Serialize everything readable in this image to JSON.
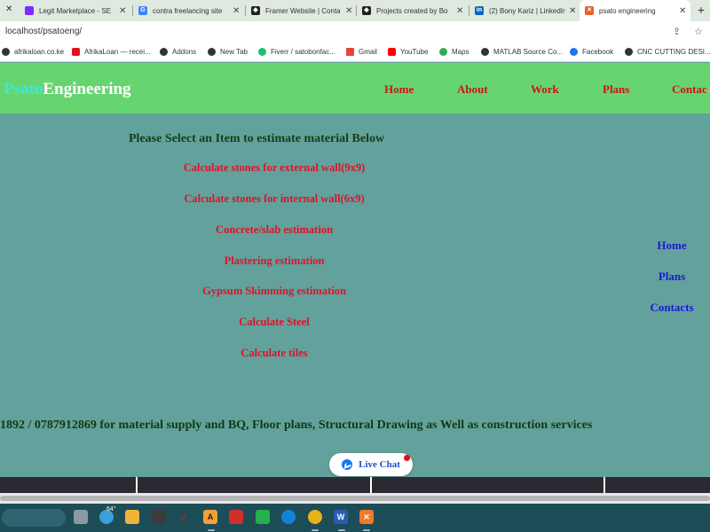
{
  "browser": {
    "tabs": [
      {
        "label": "Legit Marketplace - SE",
        "icon_color": "#7b2cff",
        "icon": "grid-icon"
      },
      {
        "label": "contra freelancing site",
        "icon_color": "#4285f4",
        "icon": "google-icon"
      },
      {
        "label": "Framer Website | Conta",
        "icon_color": "#222222",
        "icon": "framer-icon"
      },
      {
        "label": "Projects created by Bo",
        "icon_color": "#222222",
        "icon": "framer-icon"
      },
      {
        "label": "(2) Bony Kariz | LinkedIn",
        "icon_color": "#0a66c2",
        "icon": "linkedin-icon"
      },
      {
        "label": "psato engineering",
        "icon_color": "#e8612c",
        "icon": "xampp-icon",
        "active": true
      }
    ],
    "url": "localhost/psatoeng/",
    "bookmarks": [
      {
        "label": "afrikaloan.co.ke",
        "color": "#333333"
      },
      {
        "label": "AfrikaLoan — recei...",
        "color": "#e2101a"
      },
      {
        "label": "Addons",
        "color": "#333333"
      },
      {
        "label": "New Tab",
        "color": "#333333"
      },
      {
        "label": "Fiverr / satobonfac...",
        "color": "#1dbf73"
      },
      {
        "label": "Gmail",
        "color": "#ea4335"
      },
      {
        "label": "YouTube",
        "color": "#ff0000"
      },
      {
        "label": "Maps",
        "color": "#34a853"
      },
      {
        "label": "MATLAB Source Co...",
        "color": "#333333"
      },
      {
        "label": "Facebook",
        "color": "#1877f2"
      },
      {
        "label": "CNC CUTTING DESI...",
        "color": "#333333"
      }
    ]
  },
  "site": {
    "brand_part1": "Psato",
    "brand_part2": "Engineering",
    "nav": [
      "Home",
      "About",
      "Work",
      "Plans",
      "Contac"
    ],
    "heading": "Please Select an Item to estimate material Below",
    "calc_links": [
      "Calculate stones for external wall(9x9)",
      "Calculate stones for internal wall(6x9)",
      "Concrete/slab estimation",
      "Plastering estimation",
      "Gypsum Skimming estimation",
      "Calculate Steel",
      "Calculate tiles"
    ],
    "side_links": [
      "Home",
      "Plans",
      "Contacts"
    ],
    "contact_line": "1892 / 0787912869 for material supply and BQ, Floor plans, Structural Drawing as Well as construction services",
    "live_chat_label": "Live Chat"
  },
  "taskbar": {
    "temperature": "64°"
  },
  "colors": {
    "page_bg": "#63a19c",
    "header_bg": "#67d56f",
    "nav_link": "#d0101a",
    "calc_link": "#e0122a",
    "side_link": "#1a1ad6",
    "heading": "#143e14"
  }
}
